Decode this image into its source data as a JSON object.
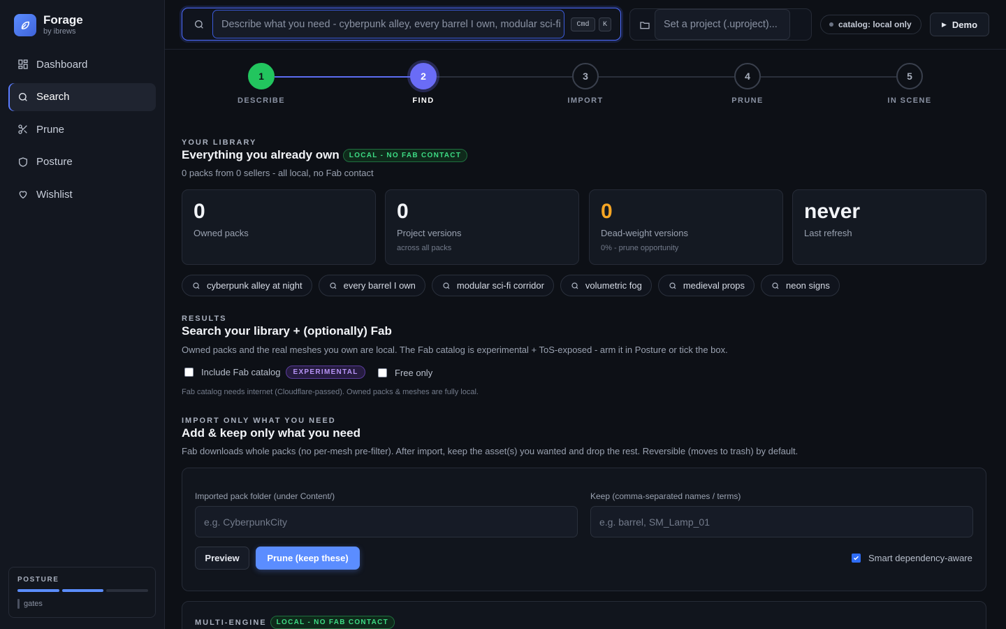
{
  "brand": {
    "name": "Forage",
    "sub": "by ibrews"
  },
  "nav": [
    {
      "label": "Dashboard",
      "icon": "grid-icon",
      "active": false
    },
    {
      "label": "Search",
      "icon": "search-icon",
      "active": true
    },
    {
      "label": "Prune",
      "icon": "scissors-icon",
      "active": false
    },
    {
      "label": "Posture",
      "icon": "shield-icon",
      "active": false
    },
    {
      "label": "Wishlist",
      "icon": "heart-icon",
      "active": false
    }
  ],
  "posture": {
    "title": "POSTURE",
    "gates": "gates",
    "segments_on": 2,
    "segments_total": 3
  },
  "topbar": {
    "search_placeholder": "Describe what you need - cyberpunk alley, every barrel I own, modular sci-fi corridor",
    "kbd_cmd": "Cmd",
    "kbd_k": "K",
    "project_placeholder": "Set a project (.uproject)...",
    "catalog": "catalog: local only",
    "demo": "Demo"
  },
  "stepper": {
    "current": 2,
    "steps": [
      {
        "num": "1",
        "label": "DESCRIBE",
        "state": "done"
      },
      {
        "num": "2",
        "label": "FIND",
        "state": "active"
      },
      {
        "num": "3",
        "label": "IMPORT",
        "state": "todo"
      },
      {
        "num": "4",
        "label": "PRUNE",
        "state": "todo"
      },
      {
        "num": "5",
        "label": "IN SCENE",
        "state": "todo"
      }
    ]
  },
  "library": {
    "eyebrow": "YOUR LIBRARY",
    "title": "Everything you already own",
    "badge": "LOCAL - NO FAB CONTACT",
    "sub": "0 packs from 0 sellers - all local, no Fab contact",
    "stats": [
      {
        "value": "0",
        "label": "Owned packs",
        "small": ""
      },
      {
        "value": "0",
        "label": "Project versions",
        "small": "across all packs"
      },
      {
        "value": "0",
        "label": "Dead-weight versions",
        "small": "0% - prune opportunity"
      },
      {
        "value": "never",
        "label": "Last refresh",
        "small": ""
      }
    ],
    "accent_orange": "#f5a524"
  },
  "chips": [
    "cyberpunk alley at night",
    "every barrel I own",
    "modular sci-fi corridor",
    "volumetric fog",
    "medieval props",
    "neon signs"
  ],
  "results": {
    "eyebrow": "RESULTS",
    "title": "Search your library + (optionally) Fab",
    "sub": "Owned packs and the real meshes you own are local. The Fab catalog is experimental + ToS-exposed - arm it in Posture or tick the box.",
    "include_fab": "Include Fab catalog",
    "include_fab_checked": false,
    "experimental": "EXPERIMENTAL",
    "free_only": "Free only",
    "free_only_checked": false,
    "note": "Fab catalog needs internet (Cloudflare-passed). Owned packs & meshes are fully local."
  },
  "import": {
    "eyebrow": "IMPORT ONLY WHAT YOU NEED",
    "title": "Add & keep only what you need",
    "sub": "Fab downloads whole packs (no per-mesh pre-filter). After import, keep the asset(s) you wanted and drop the rest. Reversible (moves to trash) by default.",
    "folder_label": "Imported pack folder (under Content/)",
    "folder_placeholder": "e.g. CyberpunkCity",
    "keep_label": "Keep (comma-separated names / terms)",
    "keep_placeholder": "e.g. barrel, SM_Lamp_01",
    "preview": "Preview",
    "prune": "Prune (keep these)",
    "smart": "Smart dependency-aware",
    "smart_checked": true
  },
  "multi": {
    "eyebrow": "MULTI-ENGINE",
    "badge": "LOCAL - NO FAB CONTACT"
  }
}
